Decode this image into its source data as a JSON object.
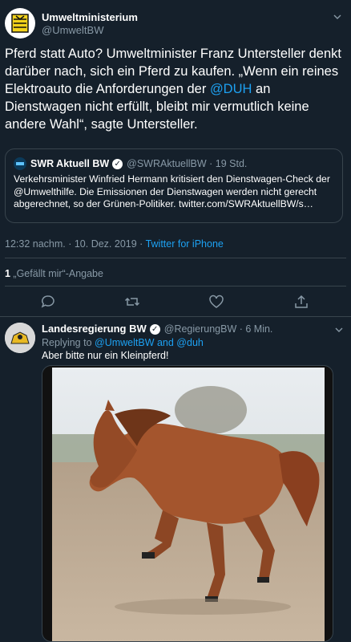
{
  "main_tweet": {
    "author_name": "Umweltministerium",
    "author_handle": "@UmweltBW",
    "text_before": "Pferd statt Auto? Umweltminister Franz Untersteller denkt darüber nach, sich ein Pferd zu kaufen. „Wenn ein reines Elektroauto die Anforderungen der ",
    "mention": "@DUH",
    "text_after": " an Dienstwagen nicht erfüllt, bleibt mir vermutlich keine andere Wahl“, sagte Untersteller.",
    "timestamp": "12:32 nachm. · 10. Dez. 2019 · ",
    "source": "Twitter for iPhone",
    "likes_count": "1",
    "likes_label": " „Gefällt mir“-Angabe"
  },
  "quoted_tweet": {
    "author_name": "SWR Aktuell BW",
    "author_handle": "@SWRAktuellBW · 19 Std.",
    "text": "Verkehrsminister Winfried Hermann kritisiert den Dienstwagen-Check der @Umwelthilfe. Die Emissionen der Dienstwagen werden nicht gerecht abgerechnet, so der Grünen-Politiker. twitter.com/SWRAktuellBW/s…"
  },
  "reply_tweet": {
    "author_name": "Landesregierung BW",
    "author_handle": "@RegierungBW · 6 Min.",
    "replying_prefix": "Replying to ",
    "replying_to": "@UmweltBW and @duh",
    "text": "Aber bitte nur ein Kleinpferd!"
  },
  "colors": {
    "background": "#15202b",
    "link": "#1da1f2",
    "muted": "#8899a6",
    "border": "#38444d"
  },
  "icons": [
    "chevron-down-icon",
    "verified-badge-icon",
    "reply-icon",
    "retweet-icon",
    "like-icon",
    "share-icon"
  ]
}
